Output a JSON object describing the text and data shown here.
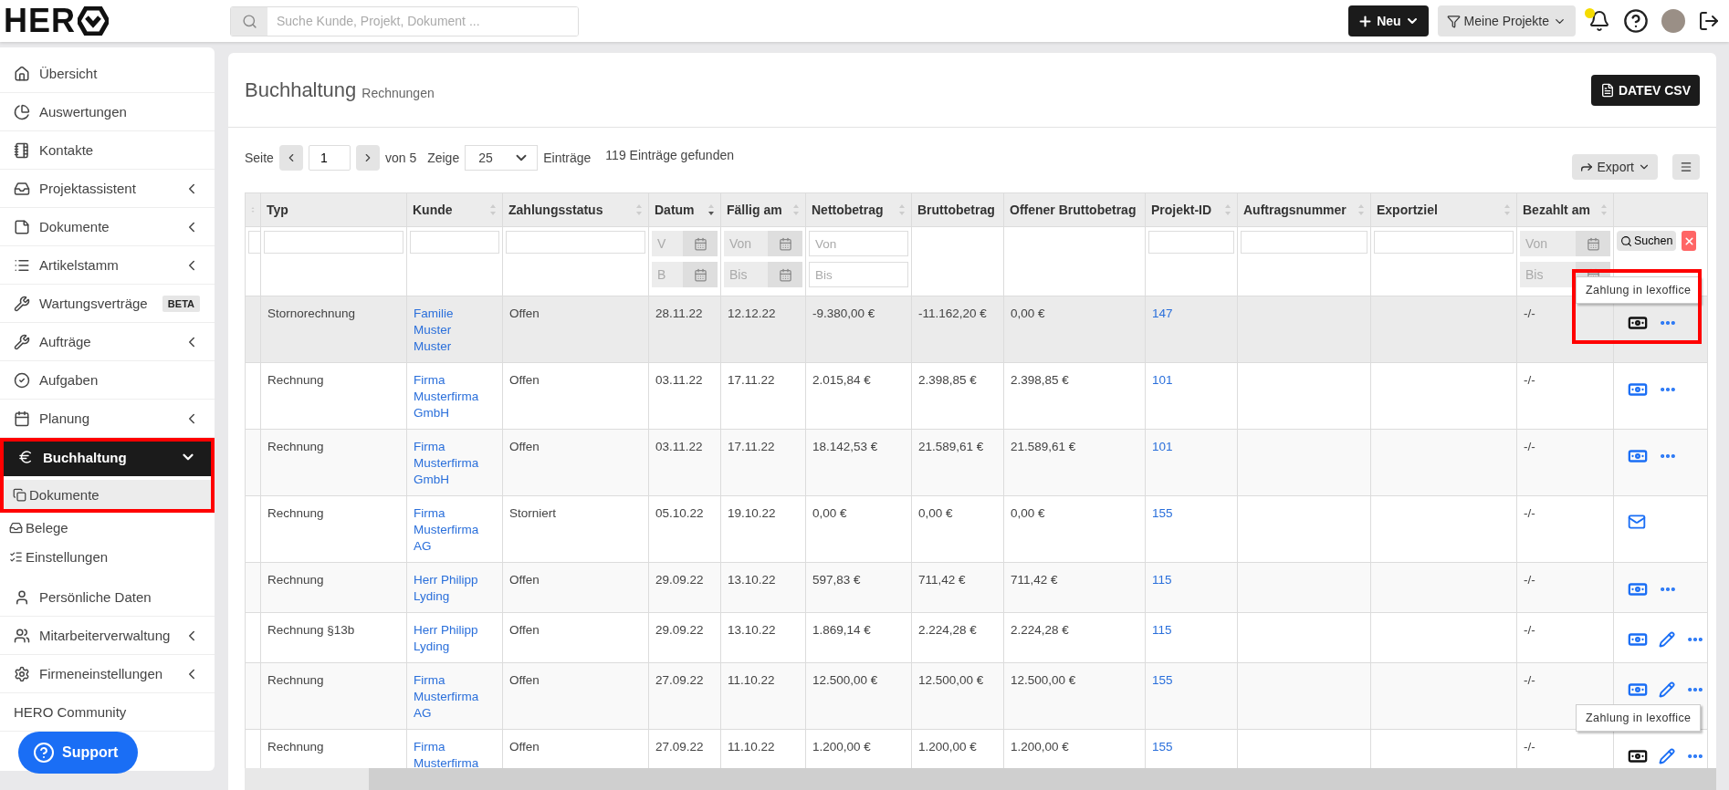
{
  "brand": {
    "name": "HER"
  },
  "search": {
    "placeholder": "Suche Kunde, Projekt, Dokument ..."
  },
  "topbar": {
    "new_button": "Neu",
    "filter_button": "Meine Projekte",
    "notification_dot": true
  },
  "sidebar": {
    "items": [
      {
        "label": "Übersicht",
        "expandable": false,
        "selected": false
      },
      {
        "label": "Auswertungen",
        "expandable": false,
        "selected": false
      },
      {
        "label": "Kontakte",
        "expandable": false,
        "selected": false
      },
      {
        "label": "Projektassistent",
        "expandable": true,
        "selected": false
      },
      {
        "label": "Dokumente",
        "expandable": true,
        "selected": false
      },
      {
        "label": "Artikelstamm",
        "expandable": true,
        "selected": false
      },
      {
        "label": "Wartungsverträge",
        "expandable": false,
        "selected": false,
        "badge": "BETA"
      },
      {
        "label": "Aufträge",
        "expandable": true,
        "selected": false
      },
      {
        "label": "Aufgaben",
        "expandable": false,
        "selected": false
      },
      {
        "label": "Planung",
        "expandable": true,
        "selected": false
      },
      {
        "label": "Buchhaltung",
        "expandable": true,
        "selected": true,
        "expanded": true,
        "highlighted": true,
        "children": [
          {
            "label": "Dokumente",
            "selected": true,
            "highlighted": true
          },
          {
            "label": "Belege",
            "selected": false,
            "highlighted": false
          },
          {
            "label": "Einstellungen",
            "selected": false,
            "highlighted": false
          }
        ]
      },
      {
        "label": "Persönliche Daten",
        "expandable": false,
        "selected": false
      },
      {
        "label": "Mitarbeiterverwaltung",
        "expandable": true,
        "selected": false
      },
      {
        "label": "Firmeneinstellungen",
        "expandable": true,
        "selected": false
      },
      {
        "label": "HERO Community",
        "expandable": false,
        "selected": false
      }
    ],
    "support_button": "Support"
  },
  "page": {
    "title": "Buchhaltung",
    "subtitle": "Rechnungen",
    "datev_button": "DATEV CSV"
  },
  "pagination": {
    "page_label": "Seite",
    "page": "1",
    "of_label": "von 5",
    "show_label": "Zeige",
    "per_page": "25",
    "entries_label": "Einträge",
    "found": "119 Einträge gefunden"
  },
  "toolbar": {
    "export_button": "Export"
  },
  "table": {
    "columns": [
      {
        "sortable": true,
        "sorted": false
      },
      {
        "label": "Typ",
        "sortable": false
      },
      {
        "label": "Kunde",
        "sortable": true,
        "sorted": false
      },
      {
        "label": "Zahlungsstatus",
        "sortable": true,
        "sorted": false
      },
      {
        "label": "Datum",
        "sortable": true,
        "sorted": true
      },
      {
        "label": "Fällig am",
        "sortable": true,
        "sorted": false
      },
      {
        "label": "Nettobetrag",
        "sortable": true,
        "sorted": false
      },
      {
        "label": "Bruttobetrag",
        "sortable": false
      },
      {
        "label": "Offener Bruttobetrag",
        "sortable": false
      },
      {
        "label": "Projekt-ID",
        "sortable": true,
        "sorted": false
      },
      {
        "label": "Auftragsnummer",
        "sortable": true,
        "sorted": false
      },
      {
        "label": "Exportziel",
        "sortable": true,
        "sorted": false
      },
      {
        "label": "Bezahlt am",
        "sortable": true,
        "sorted": false
      },
      {
        "sortable": false
      }
    ],
    "filters": [
      {
        "kind": "text"
      },
      {
        "kind": "text"
      },
      {
        "kind": "text"
      },
      {
        "kind": "text"
      },
      {
        "kind": "date_range",
        "fields": [
          {
            "placeholder": "V"
          },
          {
            "placeholder": "B"
          }
        ]
      },
      {
        "kind": "date_range",
        "fields": [
          {
            "placeholder": "Von"
          },
          {
            "placeholder": "Bis"
          }
        ]
      },
      {
        "kind": "range",
        "fields": [
          {
            "placeholder": "Von"
          },
          {
            "placeholder": "Bis"
          }
        ]
      },
      {
        "kind": "none"
      },
      {
        "kind": "none"
      },
      {
        "kind": "text"
      },
      {
        "kind": "text"
      },
      {
        "kind": "text"
      },
      {
        "kind": "date_range",
        "fields": [
          {
            "placeholder": "Von"
          },
          {
            "placeholder": "Bis"
          }
        ]
      },
      {
        "kind": "search"
      }
    ],
    "search_button": "Suchen",
    "rows": [
      {
        "type": "Stornorechnung",
        "customer": "Familie Muster Muster",
        "status": "Offen",
        "date": "28.11.22",
        "due": "12.12.22",
        "net": "-9.380,00 €",
        "gross": "-11.162,20 €",
        "open_gross": "0,00 €",
        "project_id": "147",
        "paid_at": "-/-",
        "hovered": true,
        "highlighted": true,
        "tooltip": "Zahlung in lexoffice",
        "actions": [
          {
            "kind": "payment"
          },
          {
            "kind": "more"
          }
        ]
      },
      {
        "type": "Rechnung",
        "customer": "Firma Musterfirma GmbH",
        "status": "Offen",
        "date": "03.11.22",
        "due": "17.11.22",
        "net": "2.015,84 €",
        "gross": "2.398,85 €",
        "open_gross": "2.398,85 €",
        "project_id": "101",
        "paid_at": "-/-",
        "hovered": false,
        "highlighted": false,
        "actions": [
          {
            "kind": "payment"
          },
          {
            "kind": "more"
          }
        ]
      },
      {
        "type": "Rechnung",
        "customer": "Firma Musterfirma GmbH",
        "status": "Offen",
        "date": "03.11.22",
        "due": "17.11.22",
        "net": "18.142,53 €",
        "gross": "21.589,61 €",
        "open_gross": "21.589,61 €",
        "project_id": "101",
        "paid_at": "-/-",
        "hovered": false,
        "highlighted": false,
        "actions": [
          {
            "kind": "payment"
          },
          {
            "kind": "more"
          }
        ]
      },
      {
        "type": "Rechnung",
        "customer": "Firma Musterfirma AG",
        "status": "Storniert",
        "date": "05.10.22",
        "due": "19.10.22",
        "net": "0,00 €",
        "gross": "0,00 €",
        "open_gross": "0,00 €",
        "project_id": "155",
        "paid_at": "-/-",
        "hovered": false,
        "highlighted": false,
        "actions": [
          {
            "kind": "mail"
          }
        ]
      },
      {
        "type": "Rechnung",
        "customer": "Herr Philipp Lyding",
        "status": "Offen",
        "date": "29.09.22",
        "due": "13.10.22",
        "net": "597,83 €",
        "gross": "711,42 €",
        "open_gross": "711,42 €",
        "project_id": "115",
        "paid_at": "-/-",
        "hovered": false,
        "highlighted": false,
        "actions": [
          {
            "kind": "payment"
          },
          {
            "kind": "more"
          }
        ]
      },
      {
        "type": "Rechnung §13b",
        "customer": "Herr Philipp Lyding",
        "status": "Offen",
        "date": "29.09.22",
        "due": "13.10.22",
        "net": "1.869,14 €",
        "gross": "2.224,28 €",
        "open_gross": "2.224,28 €",
        "project_id": "115",
        "paid_at": "-/-",
        "hovered": false,
        "highlighted": false,
        "actions": [
          {
            "kind": "payment"
          },
          {
            "kind": "edit"
          },
          {
            "kind": "more"
          }
        ]
      },
      {
        "type": "Rechnung",
        "customer": "Firma Musterfirma AG",
        "status": "Offen",
        "date": "27.09.22",
        "due": "11.10.22",
        "net": "12.500,00 €",
        "gross": "12.500,00 €",
        "open_gross": "12.500,00 €",
        "project_id": "155",
        "paid_at": "-/-",
        "hovered": false,
        "highlighted": false,
        "actions": [
          {
            "kind": "payment"
          },
          {
            "kind": "edit"
          },
          {
            "kind": "more"
          }
        ]
      },
      {
        "type": "Rechnung",
        "customer": "Firma Musterfirma",
        "status": "Offen",
        "date": "27.09.22",
        "due": "11.10.22",
        "net": "1.200,00 €",
        "gross": "1.200,00 €",
        "open_gross": "1.200,00 €",
        "project_id": "155",
        "paid_at": "-/-",
        "hovered": false,
        "highlighted": false,
        "tooltip": "Zahlung in lexoffice",
        "actions": [
          {
            "kind": "payment"
          },
          {
            "kind": "edit"
          },
          {
            "kind": "more"
          }
        ]
      }
    ]
  }
}
